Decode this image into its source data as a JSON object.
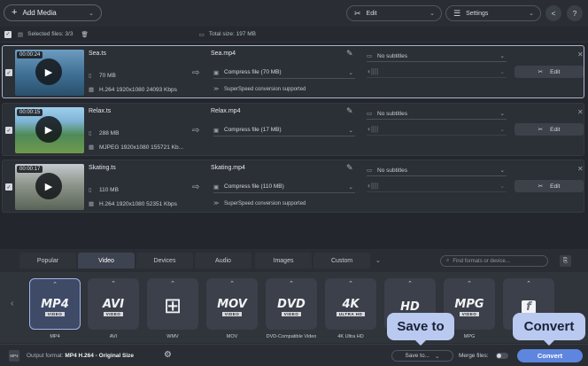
{
  "topbar": {
    "add_media": "Add Media",
    "edit": "Edit",
    "settings": "Settings"
  },
  "selection": {
    "selected_files": "Selected files: 3/3",
    "total_size": "Total size: 197 MB"
  },
  "files": [
    {
      "duration": "00:00:24",
      "name": "Sea.ts",
      "size": "70 MB",
      "codec": "H.264 1920x1080 24093 Kbps",
      "output_name": "Sea.mp4",
      "compress": "Compress file (70 MB)",
      "info": "SuperSpeed conversion supported",
      "subtitles": "No subtitles",
      "edit": "Edit",
      "thumb_colors": [
        "#5d8fb5",
        "#3d6f92",
        "#2c5270"
      ]
    },
    {
      "duration": "00:00:15",
      "name": "Relax.ts",
      "size": "288 MB",
      "codec": "MJPEG 1920x1080 155721 Kb...",
      "output_name": "Relax.mp4",
      "compress": "Compress file (17 MB)",
      "info": "",
      "subtitles": "No subtitles",
      "edit": "Edit",
      "thumb_colors": [
        "#8bc4e8",
        "#4e8a5a",
        "#6f9a52"
      ]
    },
    {
      "duration": "00:00:17",
      "name": "Skating.ts",
      "size": "110 MB",
      "codec": "H.264 1920x1080 52351 Kbps",
      "output_name": "Skating.mp4",
      "compress": "Compress file (110 MB)",
      "info": "SuperSpeed conversion supported",
      "subtitles": "No subtitles",
      "edit": "Edit",
      "thumb_colors": [
        "#b9c0c6",
        "#6f7b6a",
        "#4d5648"
      ]
    }
  ],
  "tabs": [
    "Popular",
    "Video",
    "Devices",
    "Audio",
    "Images",
    "Custom"
  ],
  "active_tab": "Video",
  "search_placeholder": "Find formats or device...",
  "formats": [
    {
      "big": "MP4",
      "small": "VIDEO",
      "label": "MP4",
      "icon": "mp4-icon"
    },
    {
      "big": "AVI",
      "small": "VIDEO",
      "label": "AVI",
      "icon": "avi-icon"
    },
    {
      "big": "",
      "small": "",
      "label": "WMV",
      "icon": "windows-icon"
    },
    {
      "big": "MOV",
      "small": "VIDEO",
      "label": "MOV",
      "icon": "mov-icon"
    },
    {
      "big": "DVD",
      "small": "VIDEO",
      "label": "DVD-Compatible Video",
      "icon": "dvd-icon"
    },
    {
      "big": "4K",
      "small": "ULTRA HD",
      "label": "4K Ultra HD",
      "icon": "4k-icon"
    },
    {
      "big": "HD",
      "small": "",
      "label": "",
      "icon": "hd-icon"
    },
    {
      "big": "MPG",
      "small": "VIDEO",
      "label": "MPG",
      "icon": "mpg-icon"
    },
    {
      "big": "f",
      "small": "",
      "label": "",
      "icon": "flash-icon"
    }
  ],
  "status": {
    "output_format_label": "Output format:",
    "output_format_value": "MP4 H.264 - Original Size",
    "save_to": "Save to...",
    "merge": "Merge files:",
    "convert": "Convert"
  },
  "callouts": {
    "save_to": "Save to",
    "convert": "Convert"
  },
  "colors": {
    "accent": "#5e86de",
    "callout": "#b9c9f0"
  }
}
